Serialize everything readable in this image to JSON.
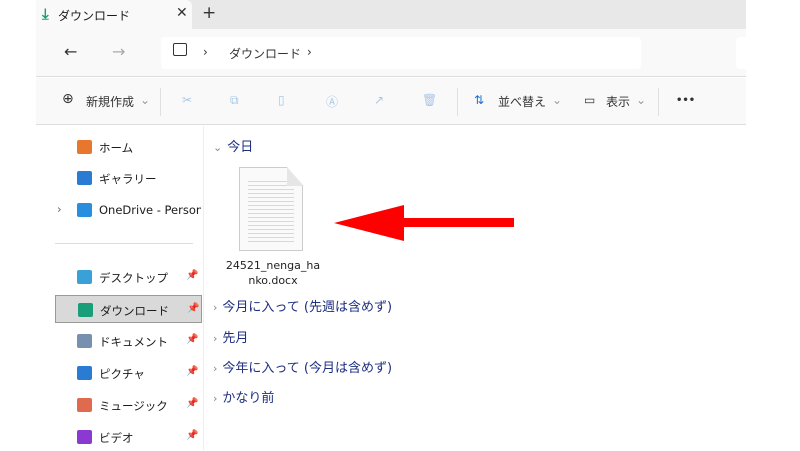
{
  "tab": {
    "title": "ダウンロード",
    "close": "✕",
    "new": "+"
  },
  "nav": {
    "back": "←",
    "forward": "→",
    "up": "↑",
    "refresh": "↻",
    "breadcrumb": [
      "ダウンロード"
    ],
    "sep": "›"
  },
  "toolbar": {
    "new_label": "新規作成",
    "sort_label": "並べ替え",
    "view_label": "表示",
    "more": "•••",
    "caret": "⌄"
  },
  "sidebar": {
    "items": [
      {
        "label": "ホーム",
        "icon": "home-icon",
        "color": "#e8772e"
      },
      {
        "label": "ギャラリー",
        "icon": "gallery-icon",
        "color": "#2a7bd4"
      },
      {
        "label": "OneDrive - Personal",
        "icon": "cloud-icon",
        "color": "#2a8ee0",
        "expand": "›"
      },
      {
        "label": "デスクトップ",
        "icon": "desktop-icon",
        "color": "#3aa0d8",
        "pinned": true
      },
      {
        "label": "ダウンロード",
        "icon": "download-icon",
        "color": "#1a9e7a",
        "pinned": true,
        "selected": true
      },
      {
        "label": "ドキュメント",
        "icon": "document-icon",
        "color": "#7890b0",
        "pinned": true
      },
      {
        "label": "ピクチャ",
        "icon": "pictures-icon",
        "color": "#2a7bd4",
        "pinned": true
      },
      {
        "label": "ミュージック",
        "icon": "music-icon",
        "color": "#e06a50",
        "pinned": true
      },
      {
        "label": "ビデオ",
        "icon": "video-icon",
        "color": "#8a3ad0",
        "pinned": true
      }
    ]
  },
  "content": {
    "groups": [
      {
        "label": "今日",
        "expanded": true
      },
      {
        "label": "今月に入って (先週は含めず)"
      },
      {
        "label": "先月"
      },
      {
        "label": "今年に入って (今月は含めず)"
      },
      {
        "label": "かなり前"
      }
    ],
    "file": {
      "name_line1": "24521_nenga_ha",
      "name_line2": "nko.docx"
    }
  },
  "annotation": {
    "color": "#ff0000",
    "icon": "red-arrow-left"
  }
}
